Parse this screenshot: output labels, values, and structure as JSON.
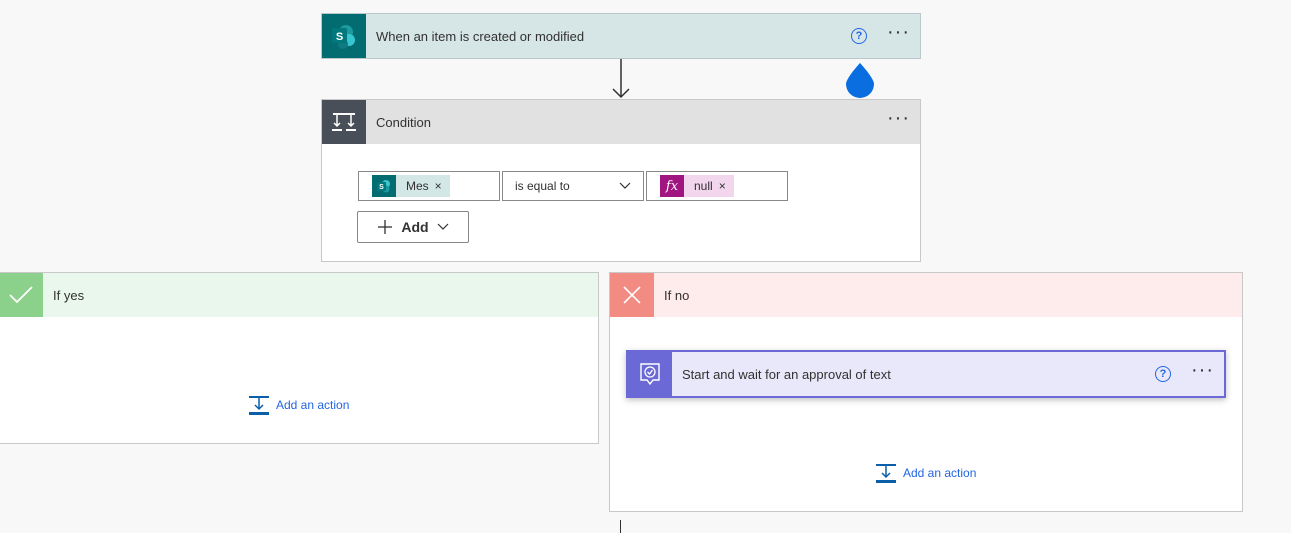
{
  "trigger": {
    "title": "When an item is created or modified",
    "help_glyph": "?",
    "more_glyph": "···",
    "icon": "sharepoint-icon",
    "color": "#036c70"
  },
  "condition": {
    "title": "Condition",
    "more_glyph": "···",
    "icon": "condition-icon",
    "left_operand": {
      "label": "Mes",
      "close": "×"
    },
    "operator": {
      "value": "is equal to"
    },
    "right_operand": {
      "label": "null",
      "close": "×",
      "icon_text": "fx"
    },
    "add_label": "Add"
  },
  "branch_yes": {
    "title": "If yes",
    "add_action_label": "Add an action",
    "color": "#8bd18b"
  },
  "branch_no": {
    "title": "If no",
    "add_action_label": "Add an action",
    "color": "#f28b82",
    "action": {
      "title": "Start and wait for an approval of text",
      "help_glyph": "?",
      "more_glyph": "···",
      "icon": "approval-icon",
      "color": "#6b69d6"
    }
  },
  "colors": {
    "accent_blue": "#2266e3",
    "drop_indicator": "#0a6ee0"
  }
}
